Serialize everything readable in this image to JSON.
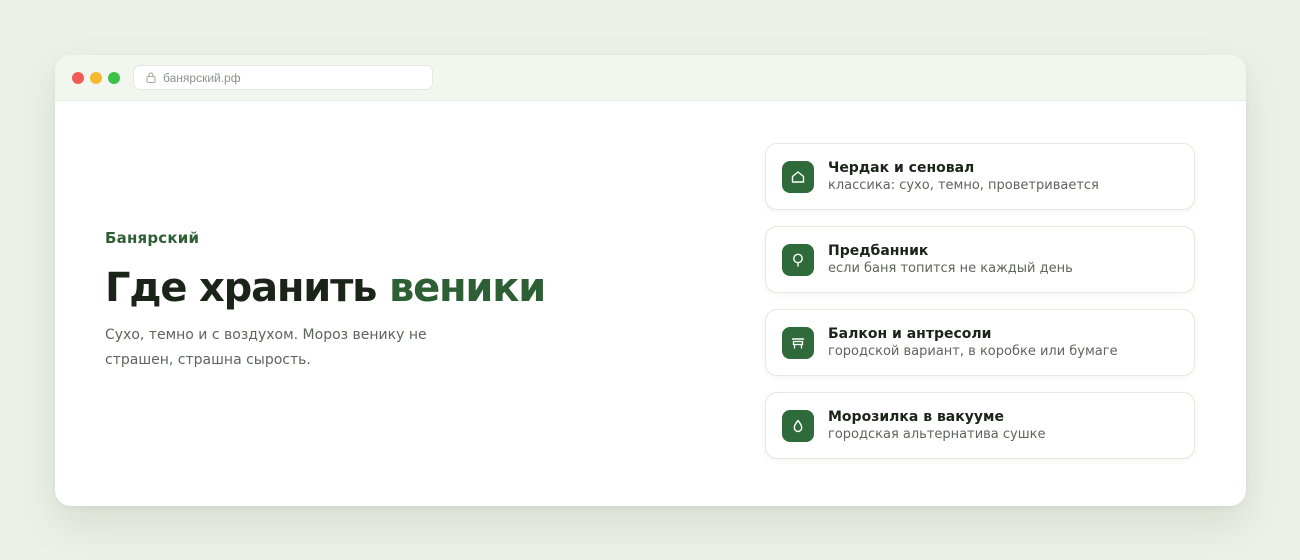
{
  "browser": {
    "url": "банярский.рф"
  },
  "hero": {
    "brand": "Банярский",
    "title_main": "Где хранить ",
    "title_accent": "веники",
    "lead": "Сухо, темно и с воздухом. Мороз венику не страшен, страшна сырость."
  },
  "options": [
    {
      "icon": "house-icon",
      "title": "Чердак и сеновал",
      "subtitle": "классика: сухо, темно, проветривается"
    },
    {
      "icon": "tree-icon",
      "title": "Предбанник",
      "subtitle": "если баня топится не каждый день"
    },
    {
      "icon": "bench-icon",
      "title": "Балкон и антресоли",
      "subtitle": "городской вариант, в коробке или бумаге"
    },
    {
      "icon": "drop-icon",
      "title": "Морозилка в вакууме",
      "subtitle": "городская альтернатива сушке"
    }
  ],
  "colors": {
    "accent": "#2d5e34",
    "icon_bg": "#2f6a3a",
    "page_bg": "#ecf1e8"
  }
}
